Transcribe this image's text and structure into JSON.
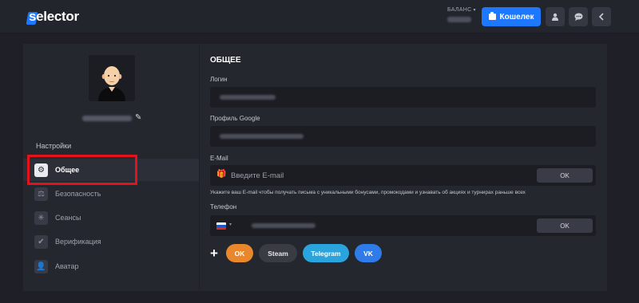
{
  "header": {
    "logo_text": "selector",
    "balance_label": "БАЛАНС",
    "wallet_label": "Кошелек",
    "icons": [
      "user-icon",
      "chat-icon",
      "back-icon"
    ]
  },
  "sidebar": {
    "settings_label": "Настройки",
    "items": [
      {
        "label": "Общее",
        "icon": "gear-icon",
        "active": true
      },
      {
        "label": "Безопасность",
        "icon": "scales-icon",
        "active": false
      },
      {
        "label": "Сеансы",
        "icon": "sessions-icon",
        "active": false
      },
      {
        "label": "Верификация",
        "icon": "verification-icon",
        "active": false
      },
      {
        "label": "Аватар",
        "icon": "avatar-icon",
        "active": false
      }
    ]
  },
  "main": {
    "section_title": "ОБЩЕЕ",
    "login_label": "Логин",
    "google_label": "Профиль Google",
    "email_label": "E-Mail",
    "email_placeholder": "Введите E-mail",
    "email_ok": "OK",
    "email_hint": "Укажите ваш E-mail чтобы получать письма с уникальными бонусами, промокодами и узнавать об акциях и турнирах раньше всех",
    "phone_label": "Телефон",
    "phone_ok": "OK",
    "socials": [
      "OK",
      "Steam",
      "Telegram",
      "VK"
    ]
  },
  "colors": {
    "accent": "#1e78ff",
    "background": "#1f2027",
    "panel": "#25272f",
    "highlight": "#e2131b",
    "ok_social": "#e8872c",
    "telegram": "#2aa4dd",
    "vk": "#2f7bea"
  }
}
